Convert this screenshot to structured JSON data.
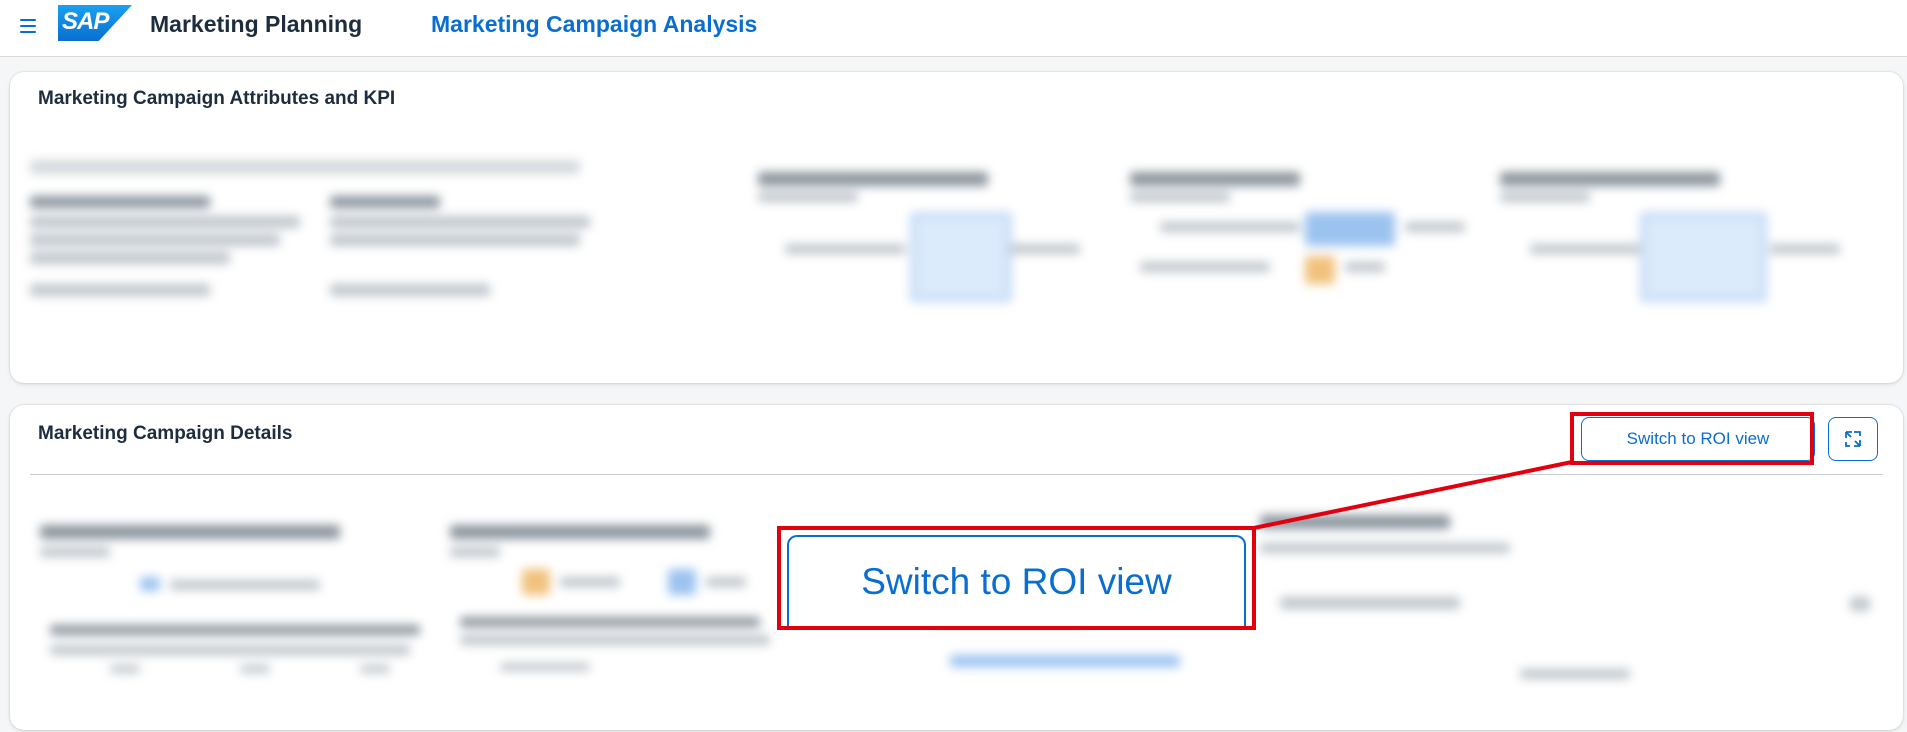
{
  "shell": {
    "logo_text": "SAP",
    "app_title": "Marketing Planning",
    "page_title": "Marketing Campaign Analysis"
  },
  "card_attributes": {
    "title": "Marketing Campaign Attributes and KPI"
  },
  "card_details": {
    "title": "Marketing Campaign Details",
    "roi_button_label": "Switch to ROI view",
    "expand_icon": "expand-icon"
  },
  "callout": {
    "zoom_label": "Switch to ROI view",
    "highlight_color": "#e2000f"
  },
  "colors": {
    "accent": "#0a6ed1",
    "text": "#1d2d3e",
    "background": "#f5f6f7"
  }
}
